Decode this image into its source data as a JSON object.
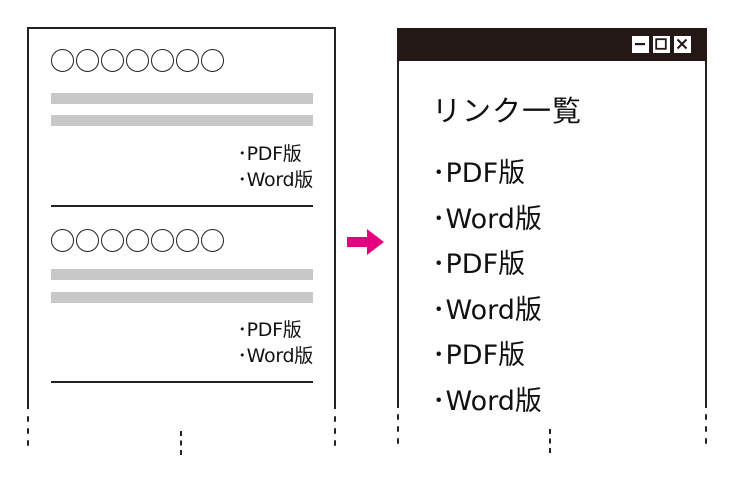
{
  "document": {
    "sections": [
      {
        "placeholder": "〇〇〇〇〇〇〇",
        "links": [
          "･PDF版",
          "･Word版"
        ]
      },
      {
        "placeholder": "〇〇〇〇〇〇〇",
        "links": [
          "･PDF版",
          "･Word版"
        ]
      }
    ]
  },
  "arrow": {
    "color": "#e4007f",
    "icon": "right-arrow-icon"
  },
  "window": {
    "title": "リンク一覧",
    "titlebar_color": "#231815",
    "controls": [
      "minimize-icon",
      "maximize-icon",
      "close-icon"
    ],
    "links": [
      "･PDF版",
      "･Word版",
      "･PDF版",
      "･Word版",
      "･PDF版",
      "･Word版"
    ]
  }
}
